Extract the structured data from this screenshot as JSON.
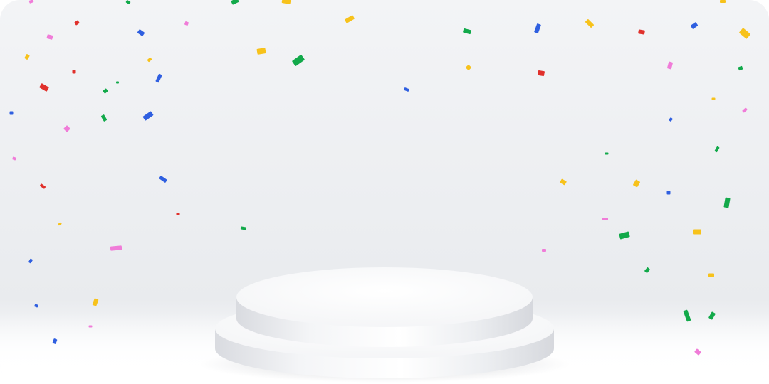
{
  "scene": {
    "background_top": "#f3f4f6",
    "background_bottom": "#ffffff"
  },
  "confetti": {
    "colors": {
      "red": "#e0302b",
      "pink": "#f07cd8",
      "yellow": "#f7c21b",
      "green": "#12a94a",
      "blue": "#2f5fe0"
    }
  },
  "podium": {
    "tiers": 2,
    "top_color": "#ffffff",
    "side_color": "#e4e6ea"
  }
}
